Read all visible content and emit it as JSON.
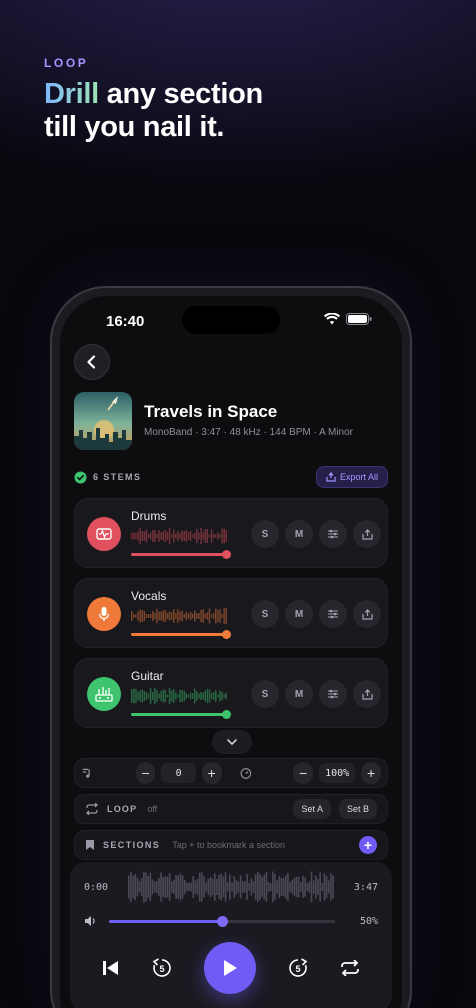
{
  "hero": {
    "eyebrow": "LOOP",
    "headline_accent": "Drill",
    "headline_rest": " any section",
    "headline_line2": "till you nail it."
  },
  "status": {
    "time": "16:40"
  },
  "song": {
    "title": "Travels in Space",
    "meta": "MonoBand · 3:47 · 48 kHz · 144 BPM · A Minor"
  },
  "stems_header": {
    "count_label": "6 STEMS",
    "export_label": "Export All"
  },
  "stems": [
    {
      "name": "Drums",
      "color": "#e0505e",
      "icon": "waveform-icon",
      "solo": "S",
      "mute": "M"
    },
    {
      "name": "Vocals",
      "color": "#f07a3a",
      "icon": "microphone-icon",
      "solo": "S",
      "mute": "M"
    },
    {
      "name": "Guitar",
      "color": "#3ec46d",
      "icon": "guitar-amp-icon",
      "solo": "S",
      "mute": "M"
    }
  ],
  "tempo": {
    "pitch_value": "0",
    "speed_value": "100%"
  },
  "loop": {
    "label": "LOOP",
    "state": "off",
    "set_a": "Set A",
    "set_b": "Set B"
  },
  "sections": {
    "label": "SECTIONS",
    "hint": "Tap + to bookmark a section"
  },
  "player": {
    "time_elapsed": "0:00",
    "time_total": "3:47",
    "volume_percent": "50%",
    "progress_fraction": 0.5,
    "accent": "#6f5cf4"
  }
}
